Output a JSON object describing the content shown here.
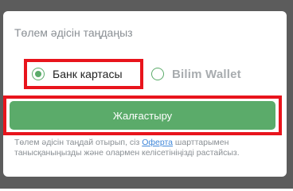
{
  "modal": {
    "title": "Төлем әдісін таңдаңыз"
  },
  "options": [
    {
      "label": "Банк картасы",
      "selected": true
    },
    {
      "label": "Bilim Wallet",
      "selected": false
    }
  ],
  "continue_button": {
    "label": "Жалғастыру"
  },
  "terms": {
    "before": "Төлем әдісін таңдай отырып, сіз ",
    "link": "Оферта",
    "after": " шарттарымен танысқаныңызды және олармен келісетініңізді растайсыз."
  },
  "colors": {
    "accent": "#5bab6a",
    "highlight": "#e8141c",
    "link": "#3e86d9"
  }
}
